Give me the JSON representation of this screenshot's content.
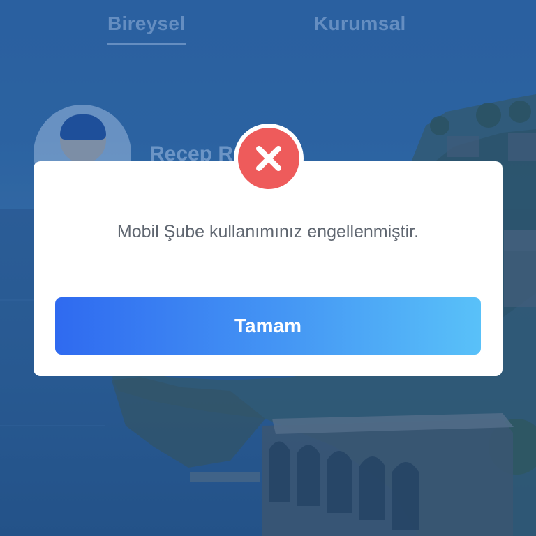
{
  "tabs": [
    {
      "label": "Bireysel",
      "active": true
    },
    {
      "label": "Kurumsal",
      "active": false
    }
  ],
  "profile": {
    "name": "Recep R"
  },
  "dialog": {
    "icon": "error-x-icon",
    "message": "Mobil Şube kullanımınız engellenmiştir.",
    "button_label": "Tamam"
  },
  "colors": {
    "error_red": "#ee5b5b",
    "button_gradient_start": "#2f6af0",
    "button_gradient_end": "#59c1f9",
    "message_text": "#5f6670",
    "background_tint": "#2f5f93"
  }
}
